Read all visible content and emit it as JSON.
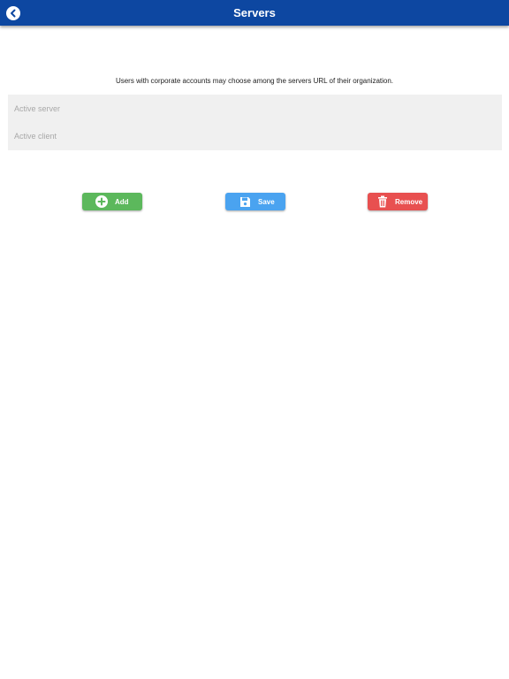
{
  "header": {
    "title": "Servers",
    "back_icon": "chevron-left-circle-icon"
  },
  "main": {
    "description": "Users with corporate accounts may choose among the servers URL of their organization.",
    "fields": {
      "active_server": {
        "placeholder": "Active server",
        "value": ""
      },
      "active_client": {
        "placeholder": "Active client",
        "value": ""
      }
    }
  },
  "actions": {
    "add": {
      "label": "Add",
      "icon": "plus-circle-icon",
      "color": "#5cb85c"
    },
    "save": {
      "label": "Save",
      "icon": "floppy-disk-icon",
      "color": "#4aa3f0"
    },
    "remove": {
      "label": "Remove",
      "icon": "trash-icon",
      "color": "#e85050"
    }
  },
  "colors": {
    "header_bg": "#0d47a1",
    "panel_bg": "#f0f0f0"
  }
}
